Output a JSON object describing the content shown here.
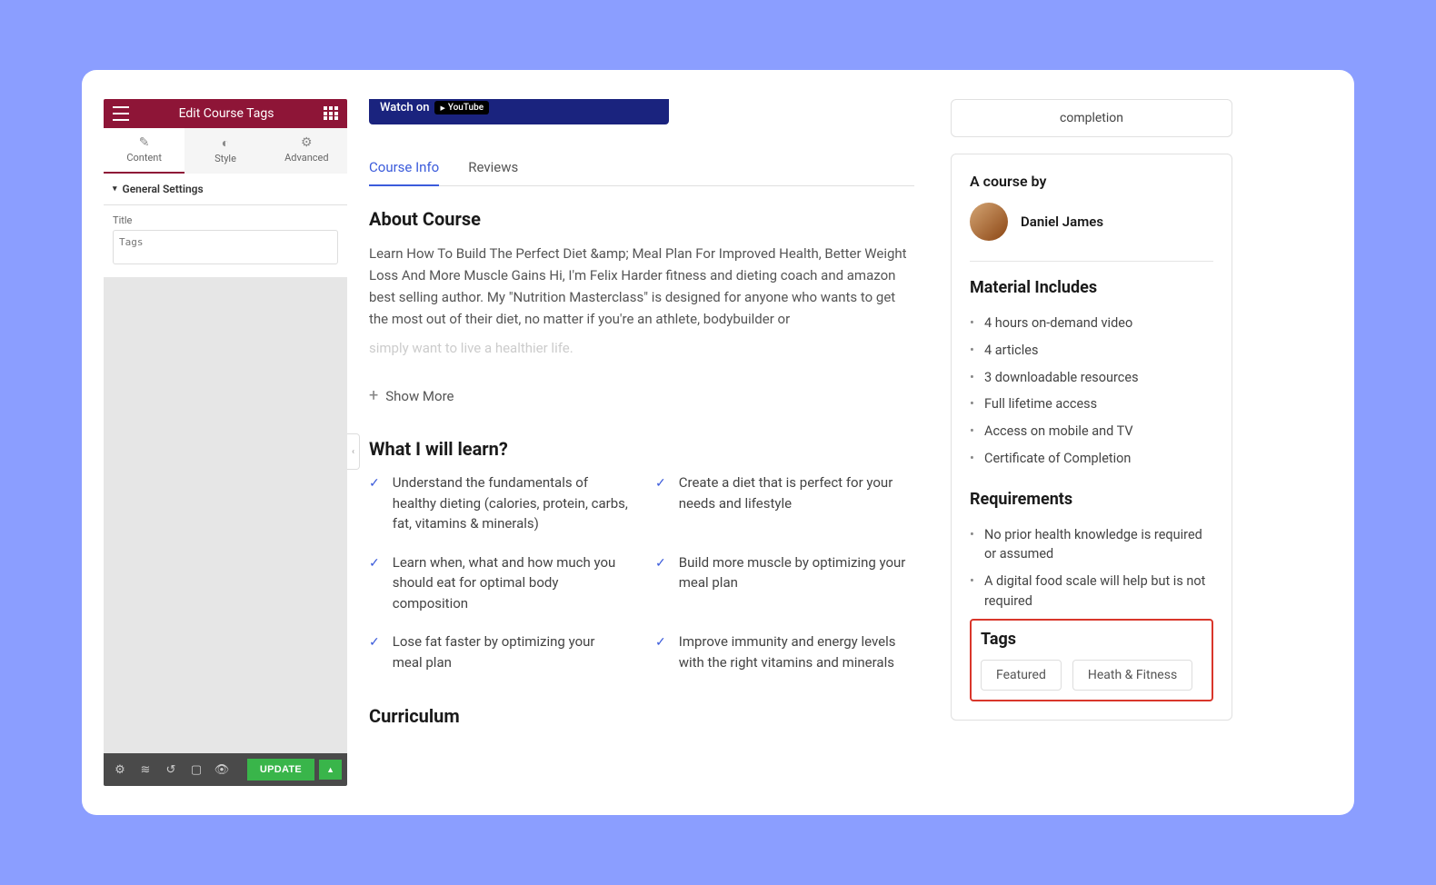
{
  "editor": {
    "title": "Edit Course Tags",
    "tabs": {
      "content": "Content",
      "style": "Style",
      "advanced": "Advanced"
    },
    "general_settings": "General Settings",
    "title_label": "Title",
    "title_placeholder": "Tags",
    "update": "UPDATE"
  },
  "video": {
    "watch_on": "Watch on",
    "youtube": "YouTube"
  },
  "tabs": {
    "info": "Course Info",
    "reviews": "Reviews"
  },
  "about": {
    "heading": "About Course",
    "body": "Learn How To Build The Perfect Diet &amp; Meal Plan For Improved Health, Better Weight Loss And More Muscle Gains Hi, I'm Felix Harder fitness and dieting coach and amazon best selling author. My \"Nutrition Masterclass\" is designed for anyone who wants to get the most out of their diet, no matter if you're an athlete, bodybuilder or",
    "body_fade": "simply want to live a healthier life.",
    "show_more": "Show More"
  },
  "learn": {
    "heading": "What I will learn?",
    "items": [
      "Understand the fundamentals of healthy dieting (calories, protein, carbs, fat, vitamins & minerals)",
      "Create a diet that is perfect for your needs and lifestyle",
      "Learn when, what and how much you should eat for optimal body composition",
      "Build more muscle by optimizing your meal plan",
      "Lose fat faster by optimizing your meal plan",
      "Improve immunity and energy levels with the right vitamins and minerals"
    ]
  },
  "curriculum": "Curriculum",
  "completion": "completion",
  "course_by": "A course by",
  "author": "Daniel James",
  "materials": {
    "heading": "Material Includes",
    "items": [
      "4 hours on-demand video",
      "4 articles",
      "3 downloadable resources",
      "Full lifetime access",
      "Access on mobile and TV",
      "Certificate of Completion"
    ]
  },
  "requirements": {
    "heading": "Requirements",
    "items": [
      "No prior health knowledge is required or assumed",
      "A digital food scale will help but is not required"
    ]
  },
  "tags": {
    "heading": "Tags",
    "items": [
      "Featured",
      "Heath & Fitness"
    ]
  }
}
